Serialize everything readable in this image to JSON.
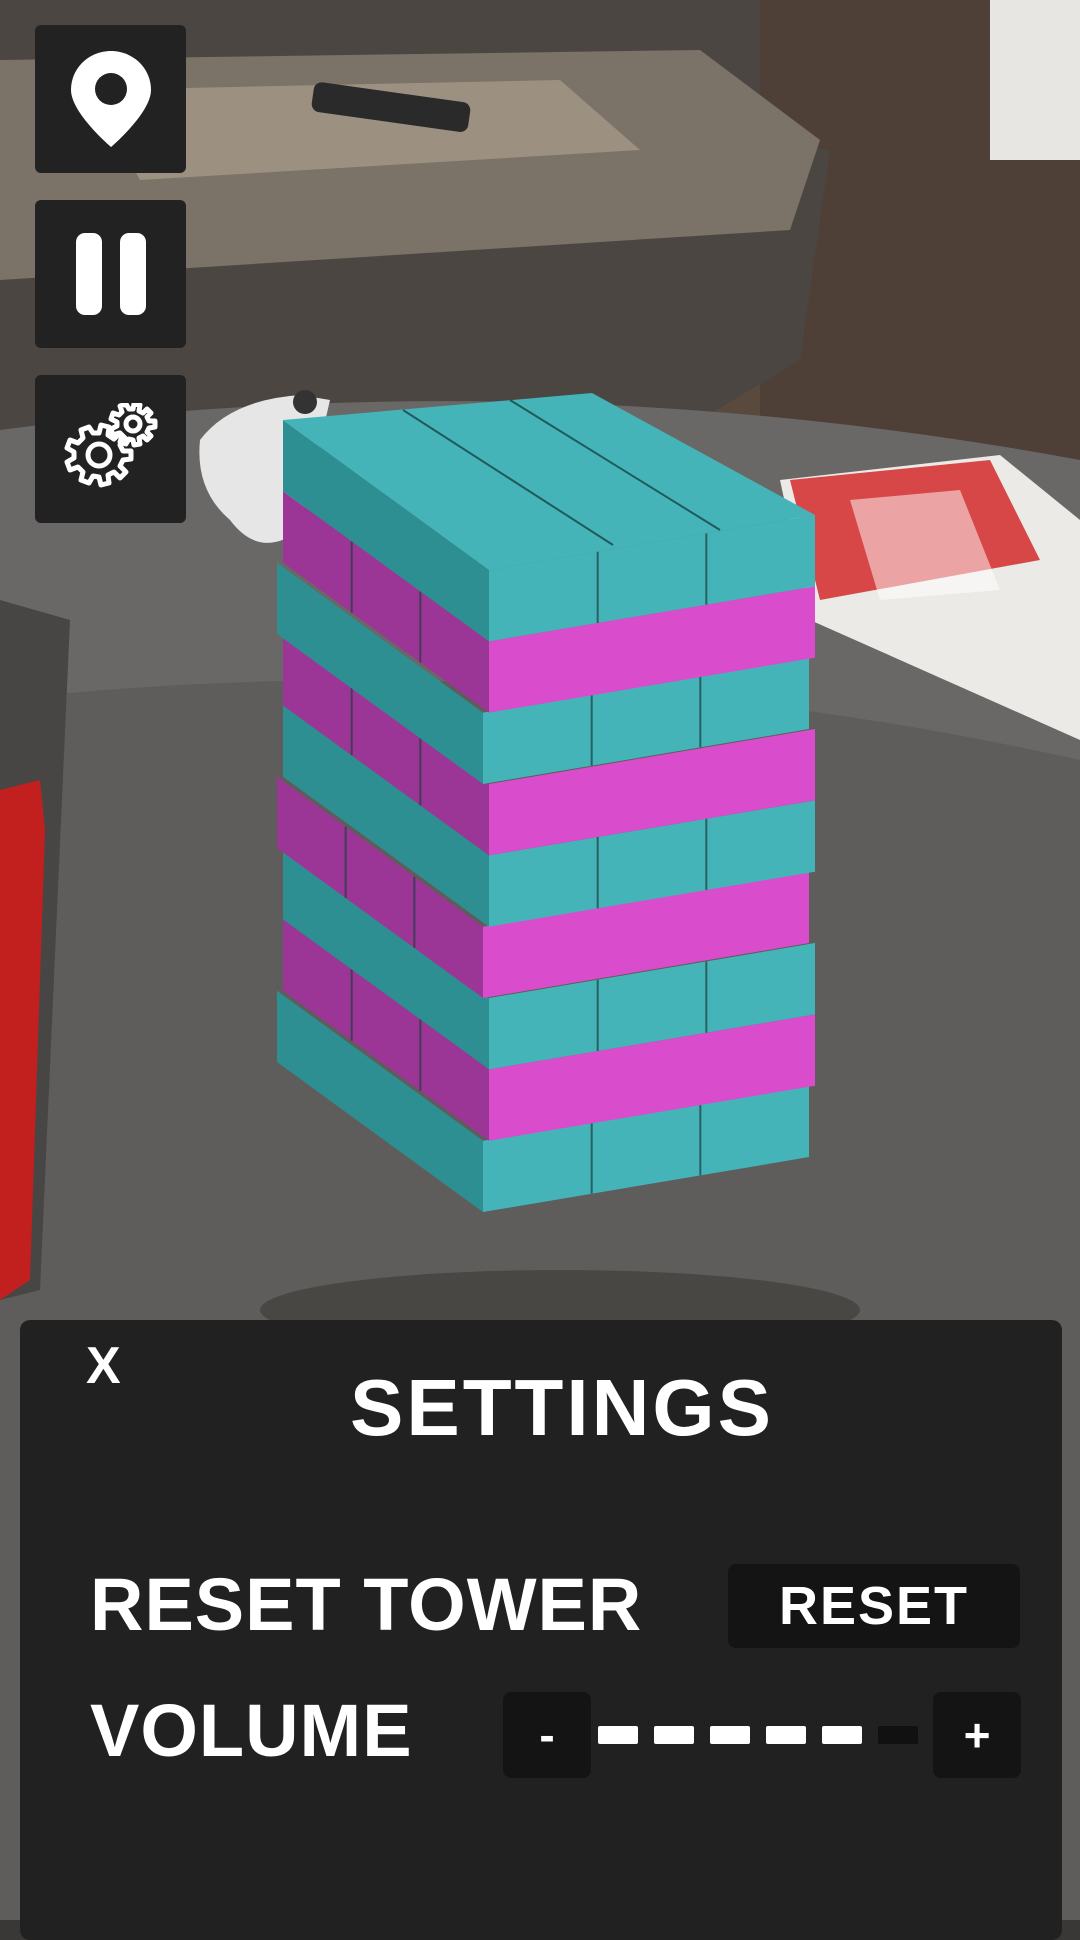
{
  "toolbar": {
    "location_icon": "map-pin-icon",
    "pause_icon": "pause-icon",
    "settings_icon": "gears-icon"
  },
  "tower": {
    "colors": {
      "teal": "#45b4b8",
      "teal_dark": "#2e8f93",
      "magenta": "#d94ccb",
      "magenta_dark": "#9b3596"
    }
  },
  "settings": {
    "close_label": "X",
    "title": "SETTINGS",
    "reset_tower_label": "RESET TOWER",
    "reset_button_label": "RESET",
    "volume_label": "VOLUME",
    "volume_minus": "-",
    "volume_plus": "+",
    "volume_level": 5,
    "volume_max": 7
  },
  "colors": {
    "panel_bg": "#212121",
    "button_bg": "#141414",
    "text": "#ffffff"
  }
}
